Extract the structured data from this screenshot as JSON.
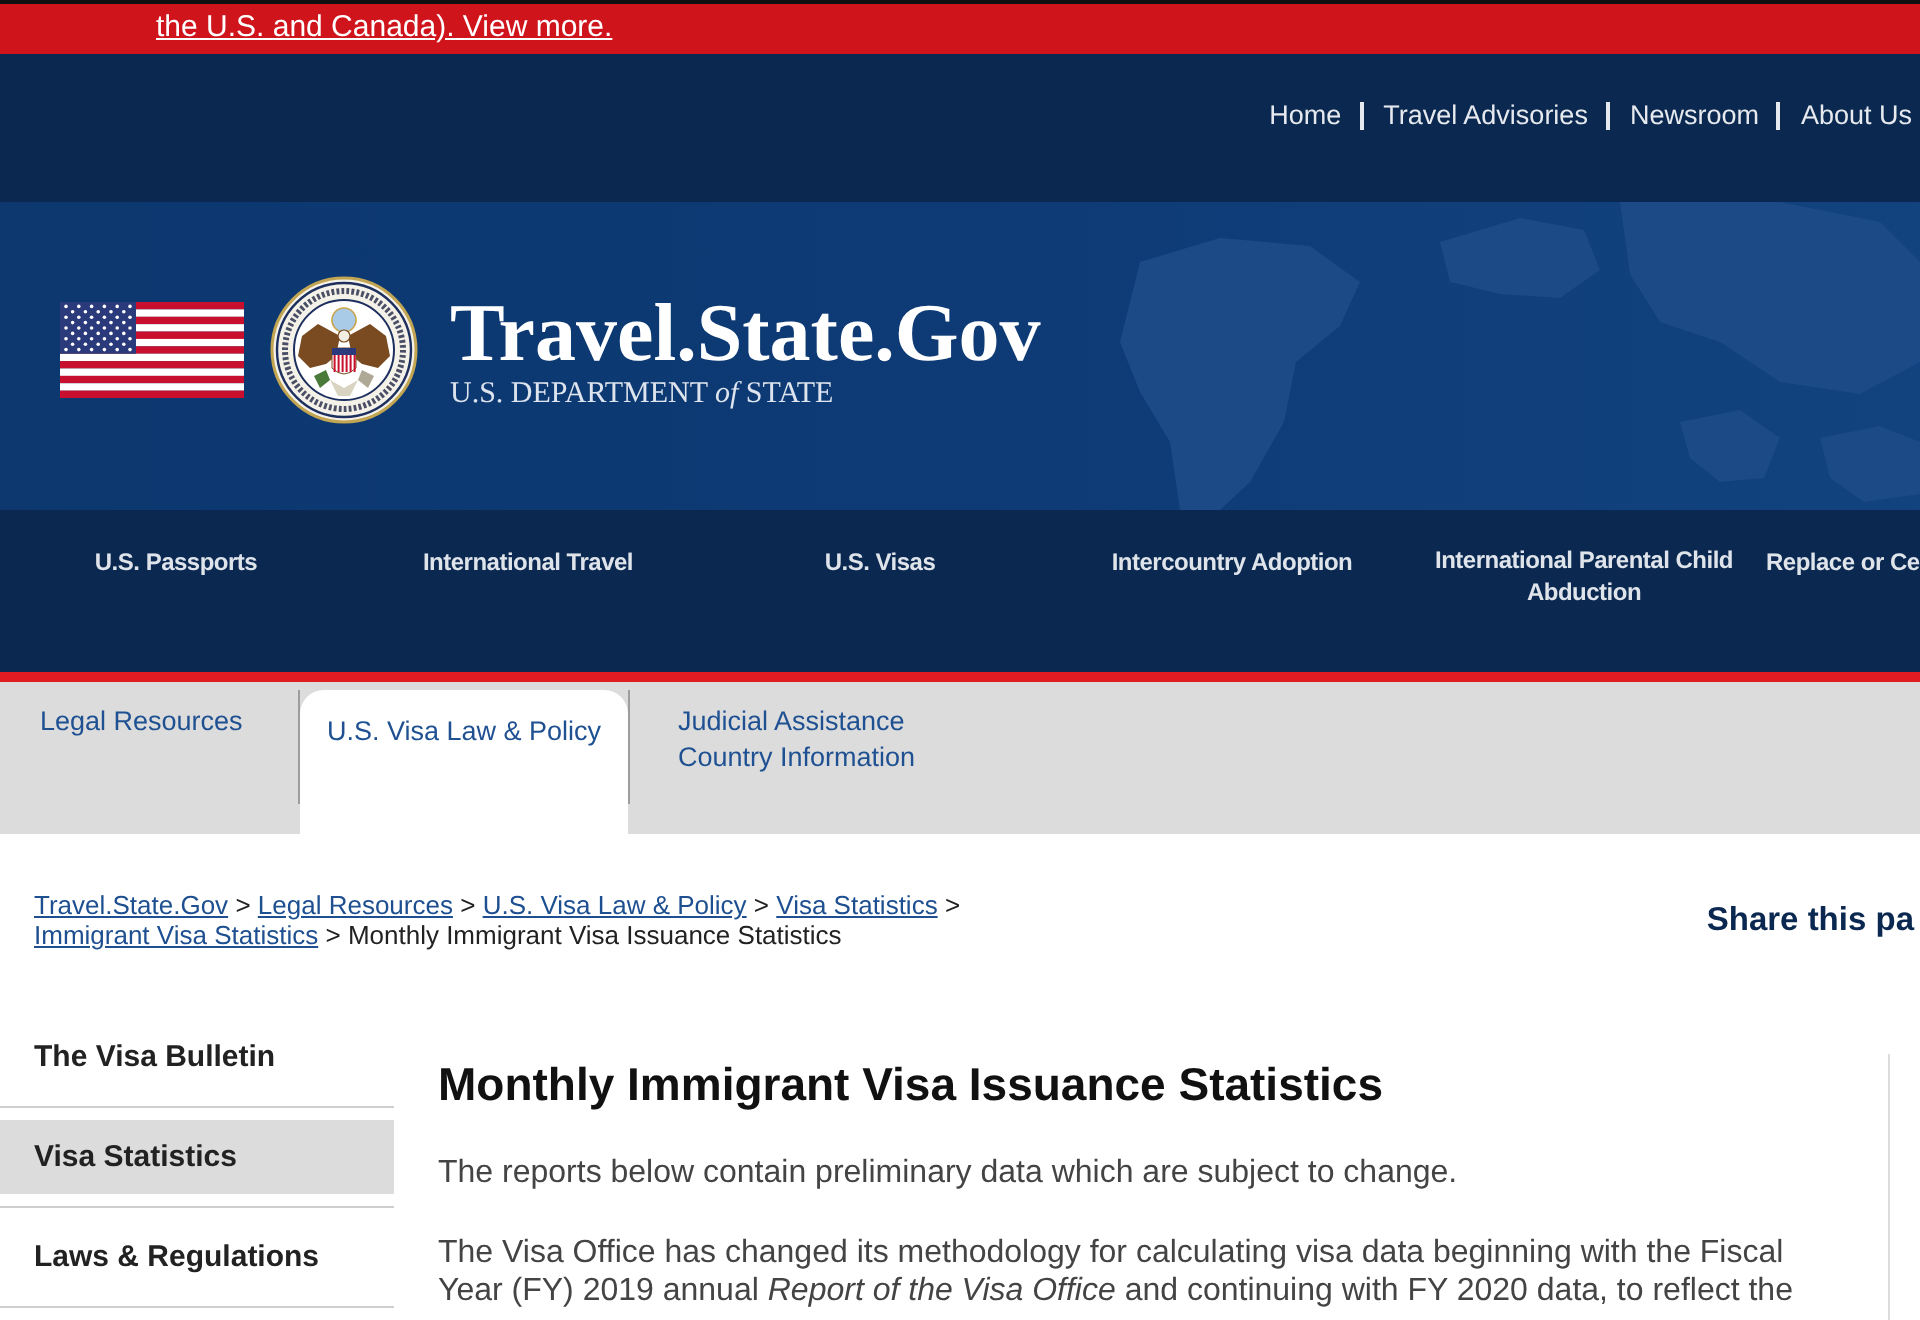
{
  "alert": {
    "text": "the U.S. and Canada). View more."
  },
  "top_links": [
    "Home",
    "Travel Advisories",
    "Newsroom",
    "About Us"
  ],
  "banner": {
    "title": "Travel.State.Gov",
    "subtitle": "U.S. DEPARTMENT *of* STATE"
  },
  "main_nav": [
    "U.S. Passports",
    "International Travel",
    "U.S. Visas",
    "Intercountry Adoption",
    "International Parental Child Abduction",
    "Replace or Ce"
  ],
  "tabs": [
    {
      "label": "Legal Resources",
      "selected": false
    },
    {
      "label": "U.S. Visa Law & Policy",
      "selected": true
    },
    {
      "label": "Judicial Assistance Country Information",
      "selected": false
    }
  ],
  "breadcrumb": [
    {
      "kind": "link",
      "label": "Travel.State.Gov"
    },
    {
      "kind": "separator",
      "label": ">"
    },
    {
      "kind": "link",
      "label": "Legal Resources"
    },
    {
      "kind": "separator",
      "label": ">"
    },
    {
      "kind": "link",
      "label": "U.S. Visa Law & Policy"
    },
    {
      "kind": "separator",
      "label": ">"
    },
    {
      "kind": "link",
      "label": "Visa Statistics"
    },
    {
      "kind": "separator",
      "label": ">"
    },
    {
      "kind": "link",
      "label": "Immigrant Visa Statistics"
    },
    {
      "kind": "separator",
      "label": ">"
    },
    {
      "kind": "current",
      "label": "Monthly Immigrant Visa Issuance Statistics"
    }
  ],
  "share": {
    "label": "Share this pa"
  },
  "sidebar": {
    "items": [
      {
        "label": "The Visa Bulletin",
        "selected": false
      },
      {
        "label": "Visa Statistics",
        "selected": true
      },
      {
        "label": "Laws & Regulations",
        "selected": false
      }
    ]
  },
  "content": {
    "title": "Monthly Immigrant Visa Issuance Statistics",
    "paragraphs": [
      "The reports below contain preliminary data which are subject to change.",
      "The Visa Office has changed its methodology for calculating visa data beginning with the Fiscal Year (FY) 2019 annual *Report of the Visa Office* and continuing with FY 2020 data, to reflect the"
    ]
  }
}
